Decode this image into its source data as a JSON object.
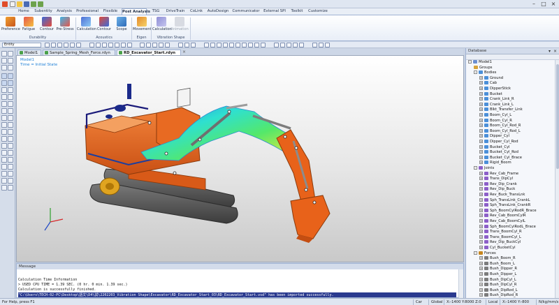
{
  "menu": {
    "tabs": [
      "Home",
      "Subentity",
      "Analysis",
      "Professional",
      "Flexible",
      "Post Analysis",
      "TSG",
      "DriveTrain",
      "CoLink",
      "AutoDesign",
      "Communicator",
      "External SPI",
      "Toolkit",
      "Customize"
    ],
    "active": "Post Analysis"
  },
  "ribbon": {
    "buttons": [
      "Preference",
      "Fatigue",
      "Contour",
      "Pre-Stress",
      "Calculation",
      "Contour",
      "Scope",
      "Movement",
      "Calculation",
      "Animation"
    ],
    "groups": [
      "Durability",
      "Acoustics",
      "Eigen",
      "Vibration Shape"
    ]
  },
  "toolbar": {
    "entity_filter": "Entity"
  },
  "doc_tabs": [
    "Model1",
    "Sample_Spring_Mesh_Force.rdyn",
    "RD_Excavator_Start.rdyn"
  ],
  "viewport": {
    "model_label": "Model1",
    "time_label": "Time = Initial State"
  },
  "panel": {
    "title": "Database",
    "root": "Model1",
    "tree": [
      {
        "label": "Model1",
        "level": 0,
        "expander": "-",
        "icon": "folder"
      },
      {
        "label": "Groups",
        "level": 1,
        "expander": "",
        "icon": "group"
      },
      {
        "label": "Bodies",
        "level": 1,
        "expander": "-",
        "icon": "body-folder"
      },
      {
        "label": "Ground",
        "level": 2,
        "expander": "+",
        "icon": "body"
      },
      {
        "label": "Cab",
        "level": 2,
        "expander": "+",
        "icon": "body"
      },
      {
        "label": "DipperStick",
        "level": 2,
        "expander": "+",
        "icon": "body"
      },
      {
        "label": "Bucket",
        "level": 2,
        "expander": "+",
        "icon": "body"
      },
      {
        "label": "Crank_Link_R",
        "level": 2,
        "expander": "+",
        "icon": "body"
      },
      {
        "label": "Crank_Link_L",
        "level": 2,
        "expander": "+",
        "icon": "body"
      },
      {
        "label": "Blkt_Transfer_Link",
        "level": 2,
        "expander": "+",
        "icon": "body"
      },
      {
        "label": "Boom_Cyl_L",
        "level": 2,
        "expander": "+",
        "icon": "body"
      },
      {
        "label": "Boom_Cyl_R",
        "level": 2,
        "expander": "+",
        "icon": "body"
      },
      {
        "label": "Boom_Cyl_Rod_R",
        "level": 2,
        "expander": "+",
        "icon": "body"
      },
      {
        "label": "Boom_Cyl_Rod_L",
        "level": 2,
        "expander": "+",
        "icon": "body"
      },
      {
        "label": "Dipper_Cyl",
        "level": 2,
        "expander": "+",
        "icon": "body"
      },
      {
        "label": "Dipper_Cyl_Rod",
        "level": 2,
        "expander": "+",
        "icon": "body"
      },
      {
        "label": "Bucket_Cyl",
        "level": 2,
        "expander": "+",
        "icon": "body"
      },
      {
        "label": "Bucket_Cyl_Rod",
        "level": 2,
        "expander": "+",
        "icon": "body"
      },
      {
        "label": "Bucket_Cyl_Brace",
        "level": 2,
        "expander": "+",
        "icon": "body"
      },
      {
        "label": "Rigid_Boom",
        "level": 2,
        "expander": "+",
        "icon": "body"
      },
      {
        "label": "Joints",
        "level": 1,
        "expander": "-",
        "icon": "joint-folder"
      },
      {
        "label": "Rev_Cab_Frame",
        "level": 2,
        "expander": "+",
        "icon": "joint"
      },
      {
        "label": "Trans_DipCyl",
        "level": 2,
        "expander": "+",
        "icon": "joint"
      },
      {
        "label": "Rev_Dip_Crank",
        "level": 2,
        "expander": "+",
        "icon": "joint"
      },
      {
        "label": "Rev_Dip_Buck",
        "level": 2,
        "expander": "+",
        "icon": "joint"
      },
      {
        "label": "Rev_Buck_TransLnk",
        "level": 2,
        "expander": "+",
        "icon": "joint"
      },
      {
        "label": "Sph_TransLink_CrankL",
        "level": 2,
        "expander": "+",
        "icon": "joint"
      },
      {
        "label": "Sph_TransLink_CrankR",
        "level": 2,
        "expander": "+",
        "icon": "joint"
      },
      {
        "label": "Sph_BoomCylRodR_Brace",
        "level": 2,
        "expander": "+",
        "icon": "joint"
      },
      {
        "label": "Rev_Cab_BoomCylR",
        "level": 2,
        "expander": "+",
        "icon": "joint"
      },
      {
        "label": "Rev_Cab_BoomCylL",
        "level": 2,
        "expander": "+",
        "icon": "joint"
      },
      {
        "label": "Sph_BoomCylRodL_Brace",
        "level": 2,
        "expander": "+",
        "icon": "joint"
      },
      {
        "label": "Trans_BoomCyl_R",
        "level": 2,
        "expander": "+",
        "icon": "joint"
      },
      {
        "label": "Trans_BoomCyl_L",
        "level": 2,
        "expander": "+",
        "icon": "joint"
      },
      {
        "label": "Rev_Dip_BuckCyl",
        "level": 2,
        "expander": "+",
        "icon": "joint"
      },
      {
        "label": "Cyl_BucketCyl",
        "level": 2,
        "expander": "+",
        "icon": "joint"
      },
      {
        "label": "Forces",
        "level": 1,
        "expander": "-",
        "icon": "force-folder"
      },
      {
        "label": "Bush_Boom_R",
        "level": 2,
        "expander": "+",
        "icon": "force"
      },
      {
        "label": "Bush_Boom_L",
        "level": 2,
        "expander": "+",
        "icon": "force"
      },
      {
        "label": "Bush_Dipper_R",
        "level": 2,
        "expander": "+",
        "icon": "force"
      },
      {
        "label": "Bush_Dipper_L",
        "level": 2,
        "expander": "+",
        "icon": "force"
      },
      {
        "label": "Bush_DipCyl_L",
        "level": 2,
        "expander": "+",
        "icon": "force"
      },
      {
        "label": "Bush_DipCyl_R",
        "level": 2,
        "expander": "+",
        "icon": "force"
      },
      {
        "label": "Bush_DipRod_L",
        "level": 2,
        "expander": "+",
        "icon": "force"
      },
      {
        "label": "Bush_DipRod_R",
        "level": 2,
        "expander": "+",
        "icon": "force"
      }
    ]
  },
  "message": {
    "title": "Message",
    "lines": [
      "Calculation Time Information",
      " > USED CPU TIME = 1.39 SEC. (0 hr.  0 min.  1.39 sec.)",
      "Calculation is successfully finished.",
      "\"C:\\Users\\TECH-02-PC\\Desktop\\語文\\D4\\試\\2202203_Vibration Shape\\Excavator\\RD_Excavator_Start_03\\RD_Excavator_Start.vsd\" has been imported successfully."
    ]
  },
  "status": {
    "help": "For Help, press F1",
    "car": "Car",
    "global": "Global",
    "coords": "X:-1400 Y:8000 Z:0",
    "local": "Local",
    "local_coords": "X:-1400 Y:-800",
    "units": "N/kg/mm/s"
  },
  "colors": {
    "accent": "#1e7fd6",
    "excavator_body": "#e8621a",
    "selection_highlight": "#2a3a8f"
  }
}
